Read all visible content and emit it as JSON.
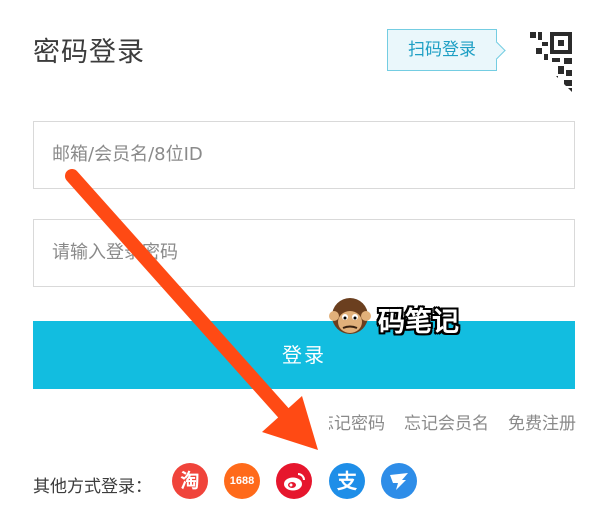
{
  "page": {
    "title": "密码登录",
    "qr_login_label": "扫码登录"
  },
  "form": {
    "username_placeholder": "邮箱/会员名/8位ID",
    "password_placeholder": "请输入登录密码",
    "submit_label": "登录"
  },
  "links": {
    "forgot_password": "忘记密码",
    "forgot_username": "忘记会员名",
    "register": "免费注册"
  },
  "other_login": {
    "label": "其他方式登录：",
    "providers": [
      {
        "name": "淘",
        "icon": "taobao-icon",
        "color": "#f0443b"
      },
      {
        "name": "1688",
        "icon": "1688-icon",
        "color": "#ff6a1a"
      },
      {
        "name": "weibo",
        "icon": "weibo-icon",
        "color": "#e6162d"
      },
      {
        "name": "支",
        "icon": "alipay-icon",
        "color": "#1e8ee8"
      },
      {
        "name": "dingtalk",
        "icon": "dingtalk-icon",
        "color": "#2e8de8"
      }
    ]
  },
  "overlay": {
    "watermark_text": "码笔记",
    "arrow_color": "#ff4a14"
  },
  "colors": {
    "accent": "#12bde0",
    "qr_tip_border": "#74cde2"
  }
}
